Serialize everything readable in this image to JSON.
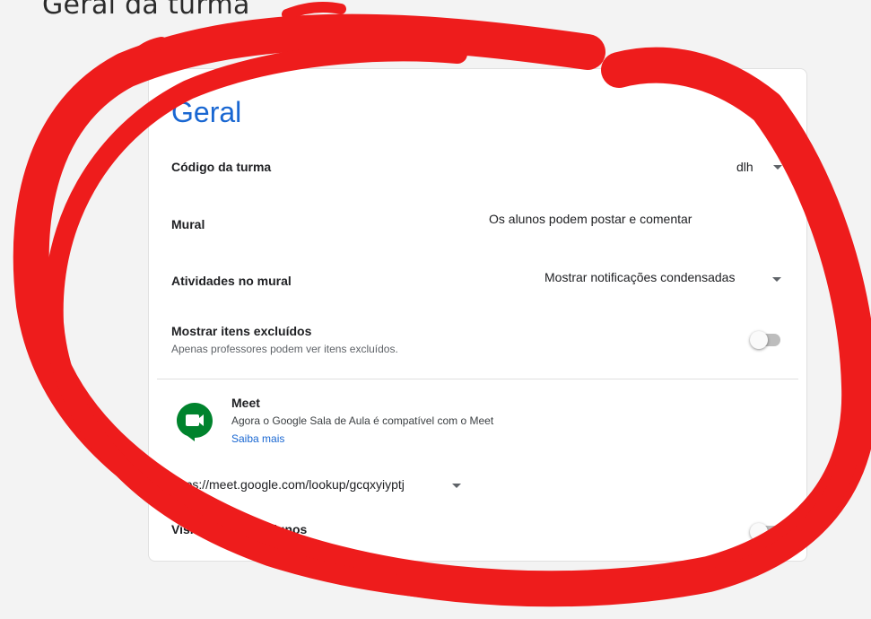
{
  "page": {
    "heading": "Geral da turma"
  },
  "card": {
    "title": "Geral",
    "class_code": {
      "label": "Código da turma",
      "value_visible_fragment": "dlh"
    },
    "stream": {
      "label": "Mural",
      "value": "Os alunos podem postar e comentar"
    },
    "classwork_on_stream": {
      "label": "Atividades no mural",
      "value": "Mostrar notificações condensadas"
    },
    "show_deleted": {
      "label": "Mostrar itens excluídos",
      "description": "Apenas professores podem ver itens excluídos.",
      "enabled": false
    },
    "meet": {
      "title": "Meet",
      "description": "Agora o Google Sala de Aula é compatível com o Meet",
      "learn_more": "Saiba mais",
      "link": "https://meet.google.com/lookup/gcqxyiyptj",
      "visible_label_fragment": "Visi",
      "visible_label_fragment_2": "os alunos",
      "visible_to_students": false
    }
  },
  "colors": {
    "accent": "#1967d2",
    "annotation": "#ee1c1c",
    "meet_green": "#00832d"
  },
  "icons": {
    "meet": "google-meet-icon",
    "dropdown": "caret-down-icon"
  }
}
